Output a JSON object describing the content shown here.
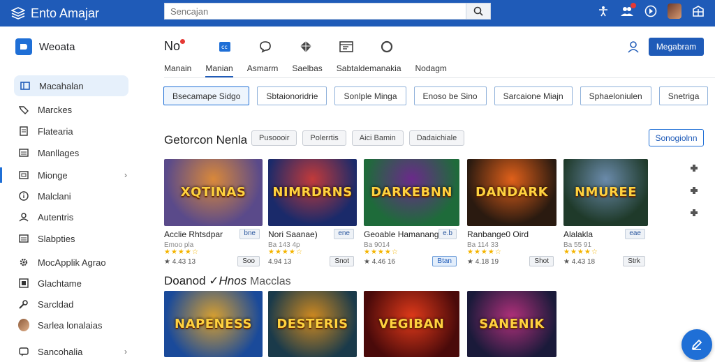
{
  "app": {
    "title": "Ento Amajar",
    "search_placeholder": "Sencajan"
  },
  "sidebar": {
    "title": "Weoata",
    "items": [
      {
        "label": "Macahalan",
        "icon": "library-icon",
        "active": true
      },
      {
        "label": "Marckes",
        "icon": "tag-icon"
      },
      {
        "label": "Flatearia",
        "icon": "document-icon"
      },
      {
        "label": "Manllages",
        "icon": "list-icon"
      },
      {
        "label": "Mionge",
        "icon": "folder-icon",
        "chevron": true
      },
      {
        "label": "Malclani",
        "icon": "info-icon"
      },
      {
        "label": "Autentris",
        "icon": "profile-icon"
      },
      {
        "label": "Slabpties",
        "icon": "list-icon"
      },
      {
        "label": "MocApplik Agrao",
        "icon": "gear-icon"
      },
      {
        "label": "Glachtame",
        "icon": "square-icon"
      },
      {
        "label": "Sarcldad",
        "icon": "wrench-icon"
      },
      {
        "label": "Sarlea lonalaias",
        "icon": "avatar"
      },
      {
        "label": "Sancohalia",
        "icon": "chat-icon",
        "chevron": true
      }
    ]
  },
  "header": {
    "title": "No",
    "register_label": "Megabram"
  },
  "tabs": [
    "Manain",
    "Manian",
    "Asmarm",
    "Saelbas",
    "Sabtaldemanakia",
    "Nodagm"
  ],
  "filters": [
    "Bsecamape Sidgo",
    "Sbtaionoridrie",
    "Sonlple Minga",
    "Enoso be Sino",
    "Sarcaione Miajn",
    "Sphaeloniulen",
    "Snetriga"
  ],
  "section1": {
    "title": "Getorcon Nenla",
    "chips": [
      "Pusoooir",
      "Polerrtis",
      "Aici Bamin",
      "Dadaichiale"
    ],
    "button": "Sonogiolnn"
  },
  "cards": [
    {
      "art": "XQTINAS",
      "title": "Acclie Rhtsdpar",
      "tag": "bne",
      "meta": "Emoo pla",
      "stars": "★★★★☆",
      "rating": "★ 4.43 13",
      "button": "Soo",
      "highlight": false,
      "colors": [
        "#5a4a8a",
        "#d9883a"
      ]
    },
    {
      "art": "NIMRDRNS",
      "title": "Nori Saanae)",
      "tag": "ene",
      "meta": "Ba 143 4p",
      "stars": "★★★★☆",
      "rating": "4.94 13",
      "button": "Snot",
      "highlight": false,
      "colors": [
        "#1a2a6a",
        "#c23a3a"
      ]
    },
    {
      "art": "DARKEBNN",
      "title": "Geoable Hamanang",
      "tag": "e.b",
      "meta": "Ba 9014",
      "stars": "★★★★☆",
      "rating": "★ 4.46 16",
      "button": "Btan",
      "highlight": true,
      "colors": [
        "#1e6b3a",
        "#6a2a8a"
      ]
    },
    {
      "art": "DANDARK",
      "title": "Ranbange0 Oird",
      "tag": "",
      "meta": "Ba 114 33",
      "stars": "★★★★☆",
      "rating": "★ 4.18 19",
      "button": "Shot",
      "highlight": false,
      "colors": [
        "#2a1a10",
        "#e0601a"
      ]
    },
    {
      "art": "NMUREE",
      "title": "Alalakla",
      "tag": "eae",
      "meta": "Ba 55 91",
      "stars": "★★★★☆",
      "rating": "★ 4.43 18",
      "button": "Strk",
      "highlight": false,
      "colors": [
        "#1f3a2a",
        "#6a8aaa"
      ]
    }
  ],
  "section2": {
    "title": "Doanod",
    "title_mid": "Hnos",
    "subtitle": "Macclas"
  },
  "cards2": [
    {
      "art": "NAPENESS",
      "colors": [
        "#1a4a9a",
        "#d8a030"
      ]
    },
    {
      "art": "DESTERIS",
      "colors": [
        "#1a3a4a",
        "#d08a20"
      ]
    },
    {
      "art": "VEGIBAN",
      "colors": [
        "#4a0a0a",
        "#e03a1a"
      ]
    },
    {
      "art": "SANENIK",
      "colors": [
        "#1a1a3a",
        "#b0307a"
      ]
    }
  ]
}
